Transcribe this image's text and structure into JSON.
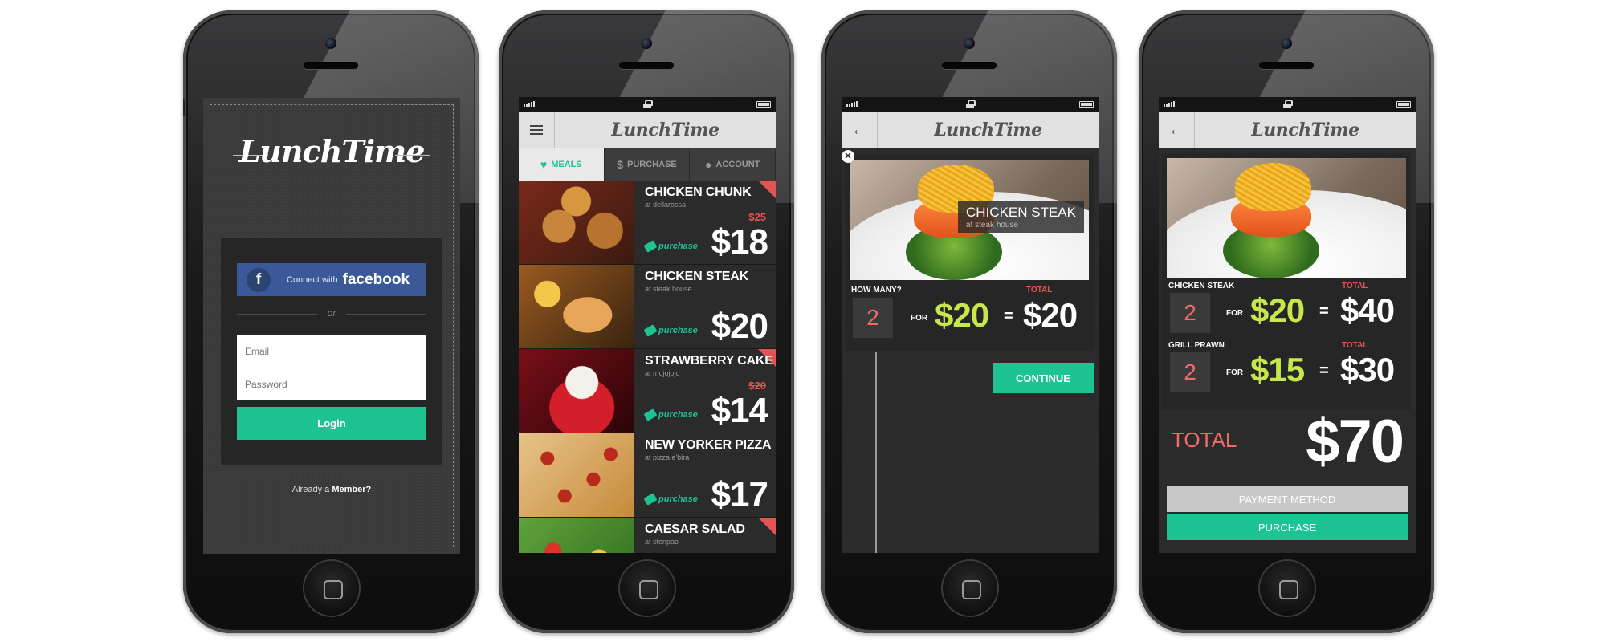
{
  "brand": "LunchTime",
  "login": {
    "fb_connect": "Connect with",
    "fb_word": "facebook",
    "or": "or",
    "email_placeholder": "Email",
    "password_placeholder": "Password",
    "login_label": "Login",
    "already": "Already a",
    "member": "Member?"
  },
  "tabs": [
    {
      "label": "MEALS",
      "icon": "heart-icon"
    },
    {
      "label": "PURCHASE",
      "icon": "dollar-icon"
    },
    {
      "label": "ACCOUNT",
      "icon": "user-icon"
    }
  ],
  "meals": [
    {
      "name": "CHICKEN CHUNK",
      "at": "at dellarossa",
      "old_price": "$25",
      "price": "$18",
      "tag": "purchase"
    },
    {
      "name": "CHICKEN STEAK",
      "at": "at steak house",
      "old_price": "",
      "price": "$20",
      "tag": "purchase"
    },
    {
      "name": "STRAWBERRY CAKE",
      "at": "at mojojojo",
      "old_price": "$20",
      "price": "$14",
      "tag": "purchase"
    },
    {
      "name": "NEW YORKER PIZZA",
      "at": "at pizza e'bira",
      "old_price": "",
      "price": "$17",
      "tag": "purchase"
    },
    {
      "name": "CAESAR SALAD",
      "at": "at stonpao",
      "old_price": "",
      "price": "",
      "tag": ""
    }
  ],
  "detail": {
    "name": "CHICKEN STEAK",
    "at": "at steak house",
    "how_many": "HOW MANY?",
    "total_label": "TOTAL",
    "qty": "2",
    "for": "FOR",
    "unit": "$20",
    "eq": "=",
    "total": "$20",
    "continue": "CONTINUE"
  },
  "cart": {
    "items": [
      {
        "name": "CHICKEN STEAK",
        "total_label": "TOTAL",
        "qty": "2",
        "for": "FOR",
        "unit": "$20",
        "eq": "=",
        "total": "$40"
      },
      {
        "name": "GRILL PRAWN",
        "total_label": "TOTAL",
        "qty": "2",
        "for": "FOR",
        "unit": "$15",
        "eq": "=",
        "total": "$30"
      }
    ],
    "total_label": "TOTAL",
    "total": "$70",
    "payment_method": "PAYMENT METHOD",
    "purchase": "PURCHASE"
  },
  "colors": {
    "accent": "#1dc393",
    "red": "#e05454",
    "lime": "#c7e74d",
    "facebook": "#3b5998"
  }
}
